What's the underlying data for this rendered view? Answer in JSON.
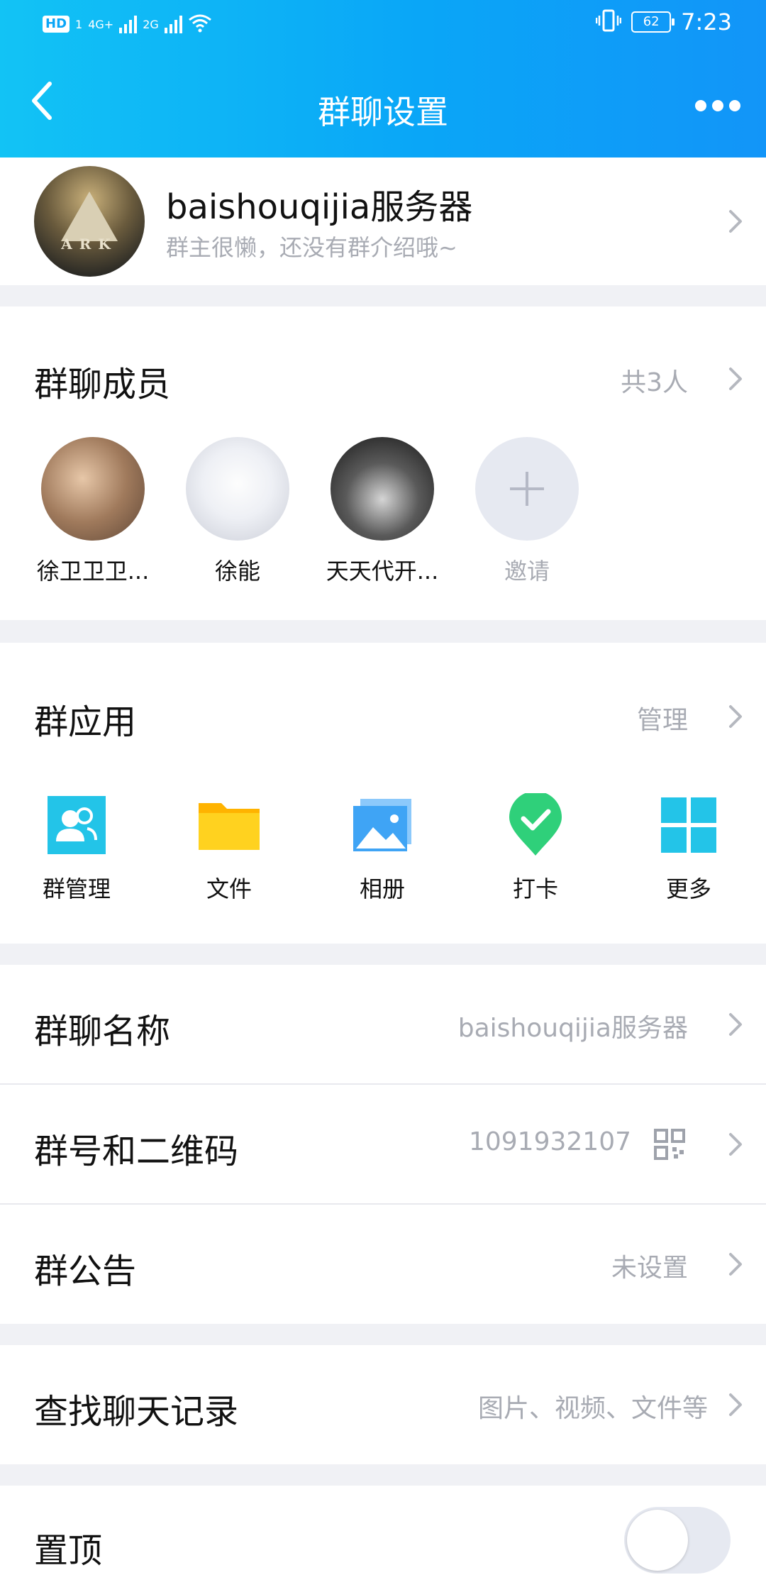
{
  "status_bar": {
    "hd": "HD",
    "sim1": "1",
    "net1": "4G+",
    "net2": "2G",
    "battery": "62",
    "time": "7:23"
  },
  "nav": {
    "title": "群聊设置"
  },
  "group": {
    "name": "baishouqijia服务器",
    "description": "群主很懒，还没有群介绍哦~",
    "avatar_text": "ARK"
  },
  "members": {
    "title": "群聊成员",
    "count": "共3人",
    "list": [
      {
        "name": "徐卫卫卫..."
      },
      {
        "name": "徐能"
      },
      {
        "name": "天天代开..."
      }
    ],
    "invite_label": "邀请"
  },
  "apps": {
    "title": "群应用",
    "manage_label": "管理",
    "items": [
      {
        "label": "群管理",
        "icon": "group-manage-icon",
        "color": "#23c4e8"
      },
      {
        "label": "文件",
        "icon": "folder-icon",
        "color": "#ffc107"
      },
      {
        "label": "相册",
        "icon": "photo-album-icon",
        "color": "#3fa4f5"
      },
      {
        "label": "打卡",
        "icon": "check-in-icon",
        "color": "#2fd07a"
      },
      {
        "label": "更多",
        "icon": "more-grid-icon",
        "color": "#23c4e8"
      }
    ]
  },
  "settings": {
    "group_name": {
      "label": "群聊名称",
      "value": "baishouqijia服务器"
    },
    "group_id": {
      "label": "群号和二维码",
      "value": "1091932107"
    },
    "announcement": {
      "label": "群公告",
      "value": "未设置"
    },
    "search_history": {
      "label": "查找聊天记录",
      "value": "图片、视频、文件等"
    },
    "pin_top": {
      "label": "置顶",
      "enabled": false
    }
  },
  "colors": {
    "accent": "#0aa6f7",
    "secondary_text": "#a8abb3",
    "background": "#f0f1f5"
  }
}
